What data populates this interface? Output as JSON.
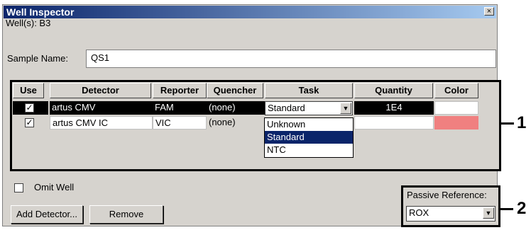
{
  "window": {
    "title": "Well Inspector",
    "close_glyph": "×"
  },
  "wells": {
    "label": "Well(s): B3"
  },
  "sample_name": {
    "label": "Sample Name:",
    "value": "QS1"
  },
  "table": {
    "headers": [
      "Use",
      "Detector",
      "Reporter",
      "Quencher",
      "Task",
      "Quantity",
      "Color"
    ],
    "rows": [
      {
        "use": "✓",
        "detector": "artus CMV",
        "reporter": "FAM",
        "quencher": "(none)",
        "task": "Standard",
        "quantity": "1E4",
        "color": "#ffffff"
      },
      {
        "use": "✓",
        "detector": "artus CMV IC",
        "reporter": "VIC",
        "quencher": "(none)",
        "task": "",
        "quantity": "",
        "color": "#f08080"
      }
    ]
  },
  "task_dropdown": {
    "arrow": "▼",
    "options": [
      "Unknown",
      "Standard",
      "NTC"
    ],
    "highlighted": "Standard"
  },
  "omit_well": {
    "label": "Omit Well"
  },
  "buttons": {
    "add_detector": "Add Detector...",
    "remove": "Remove"
  },
  "passive_reference": {
    "label": "Passive Reference:",
    "value": "ROX",
    "arrow": "▼"
  },
  "callouts": [
    "1",
    "2"
  ]
}
